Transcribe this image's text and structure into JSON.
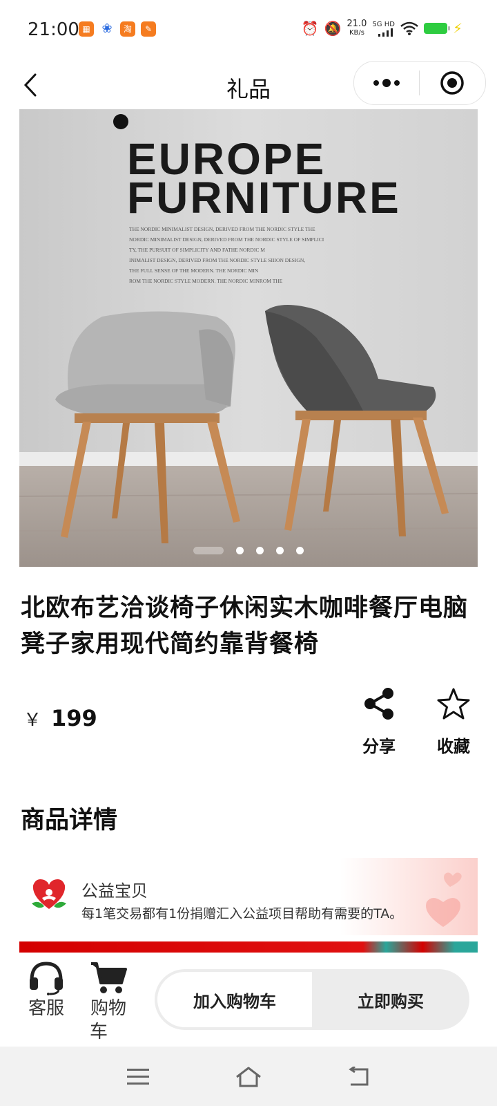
{
  "status_bar": {
    "time": "21:00",
    "net_speed_value": "21.0",
    "net_speed_unit": "KB/s",
    "net_type": "5G HD",
    "icons": [
      "alarm-icon",
      "mute-icon",
      "signal-icon",
      "wifi-icon",
      "battery-icon",
      "charging-icon"
    ]
  },
  "nav": {
    "title": "礼品"
  },
  "product": {
    "image_headline_1": "EUROPE",
    "image_headline_2": "FURNITURE",
    "image_text_lines": [
      "THE NORDIC MINIMALIST DESIGN, DERIVED FROM THE NORDIC STYLE  THE",
      "NORDIC MINIMALIST DESIGN, DERIVED FROM THE NORDIC STYLE OF SIMPLICI",
      "TY, THE PURSUIT OF SIMPLICITY AND FATHE NORDIC M",
      "INIMALIST DESIGN, DERIVED FROM THE NORDIC STYLE SIIION DESIGN,",
      "THE FULL SENSE OF THE MODERN. THE NORDIC MIN",
      "ROM THE NORDIC STYLE  MODERN. THE NORDIC MINROM THE"
    ],
    "carousel": {
      "count": 5,
      "active_index": 0
    },
    "title": "北欧布艺洽谈椅子休闲实木咖啡餐厅电脑凳子家用现代简约靠背餐椅",
    "price_symbol": "￥",
    "price": "199"
  },
  "actions": {
    "share_label": "分享",
    "favorite_label": "收藏"
  },
  "details": {
    "section_title": "商品详情",
    "charity_title": "公益宝贝",
    "charity_desc": "每1笔交易都有1份捐赠汇入公益项目帮助有需要的TA。"
  },
  "bottom_bar": {
    "service_label": "客服",
    "cart_label_1": "购物",
    "cart_label_2": "车",
    "add_to_cart": "加入购物车",
    "buy_now": "立即购买"
  },
  "colors": {
    "battery": "#2ecc40",
    "charity_red": "#e0262b",
    "button_group_bg": "#ececec"
  }
}
